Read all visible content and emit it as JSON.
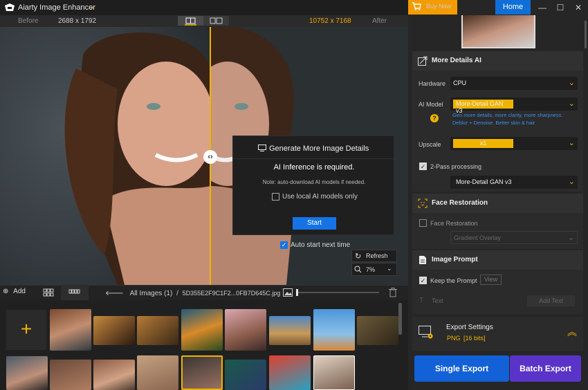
{
  "app": {
    "title": "Aiarty Image Enhancer"
  },
  "topbar": {
    "buy_now": "Buy Now",
    "home": "Home",
    "minimize": "—",
    "maximize": "☐",
    "close": "✕"
  },
  "compare": {
    "before_label": "Before",
    "before_dim": "2688 x 1792",
    "after_dim": "10752 x 7168",
    "after_label": "After"
  },
  "dialog": {
    "title": "Generate More Image Details",
    "message": "AI Inference is required.",
    "note": "Note: auto-download AI models if needed.",
    "local_models": "Use local AI models only",
    "start": "Start"
  },
  "auto_start": {
    "label": "Auto start next time",
    "checked": true
  },
  "refresh": "Refresh",
  "zoom": "7%",
  "image_bar": {
    "add": "Add",
    "all_images": "All Images (1)",
    "separator": "/",
    "filename": "5D355E2F9C1F2...0FB7D645C.jpg"
  },
  "more_details": {
    "title": "More Details AI",
    "hardware_label": "Hardware",
    "hardware_value": "CPU",
    "ai_model_label": "AI Model",
    "ai_model_value": "More-Detail GAN  v3",
    "model_desc_1": "Gen more details, more clarity, more sharpness.",
    "model_desc_2": "Deblur + Denoise. Better skin & hair",
    "upscale_label": "Upscale",
    "upscale_value": "x1",
    "two_pass_label": "2-Pass processing",
    "two_pass_checked": true,
    "two_pass_value": "More-Detail GAN  v3"
  },
  "face_restoration": {
    "title": "Face Restoration",
    "checkbox_label": "Face Restoration",
    "checked": false,
    "mode": "Gradient Overlay"
  },
  "image_prompt": {
    "title": "Image Prompt",
    "keep_label": "Keep the Prompt",
    "keep_checked": true,
    "view": "View",
    "text_label": "Text",
    "add_text": "Add Text"
  },
  "export": {
    "settings_title": "Export Settings",
    "format": "PNG",
    "bits": "[16 bits]",
    "single": "Single Export",
    "batch": "Batch Export"
  },
  "colors": {
    "accent": "#f0b400",
    "primary": "#1673e6",
    "batch": "#5a34c8"
  }
}
